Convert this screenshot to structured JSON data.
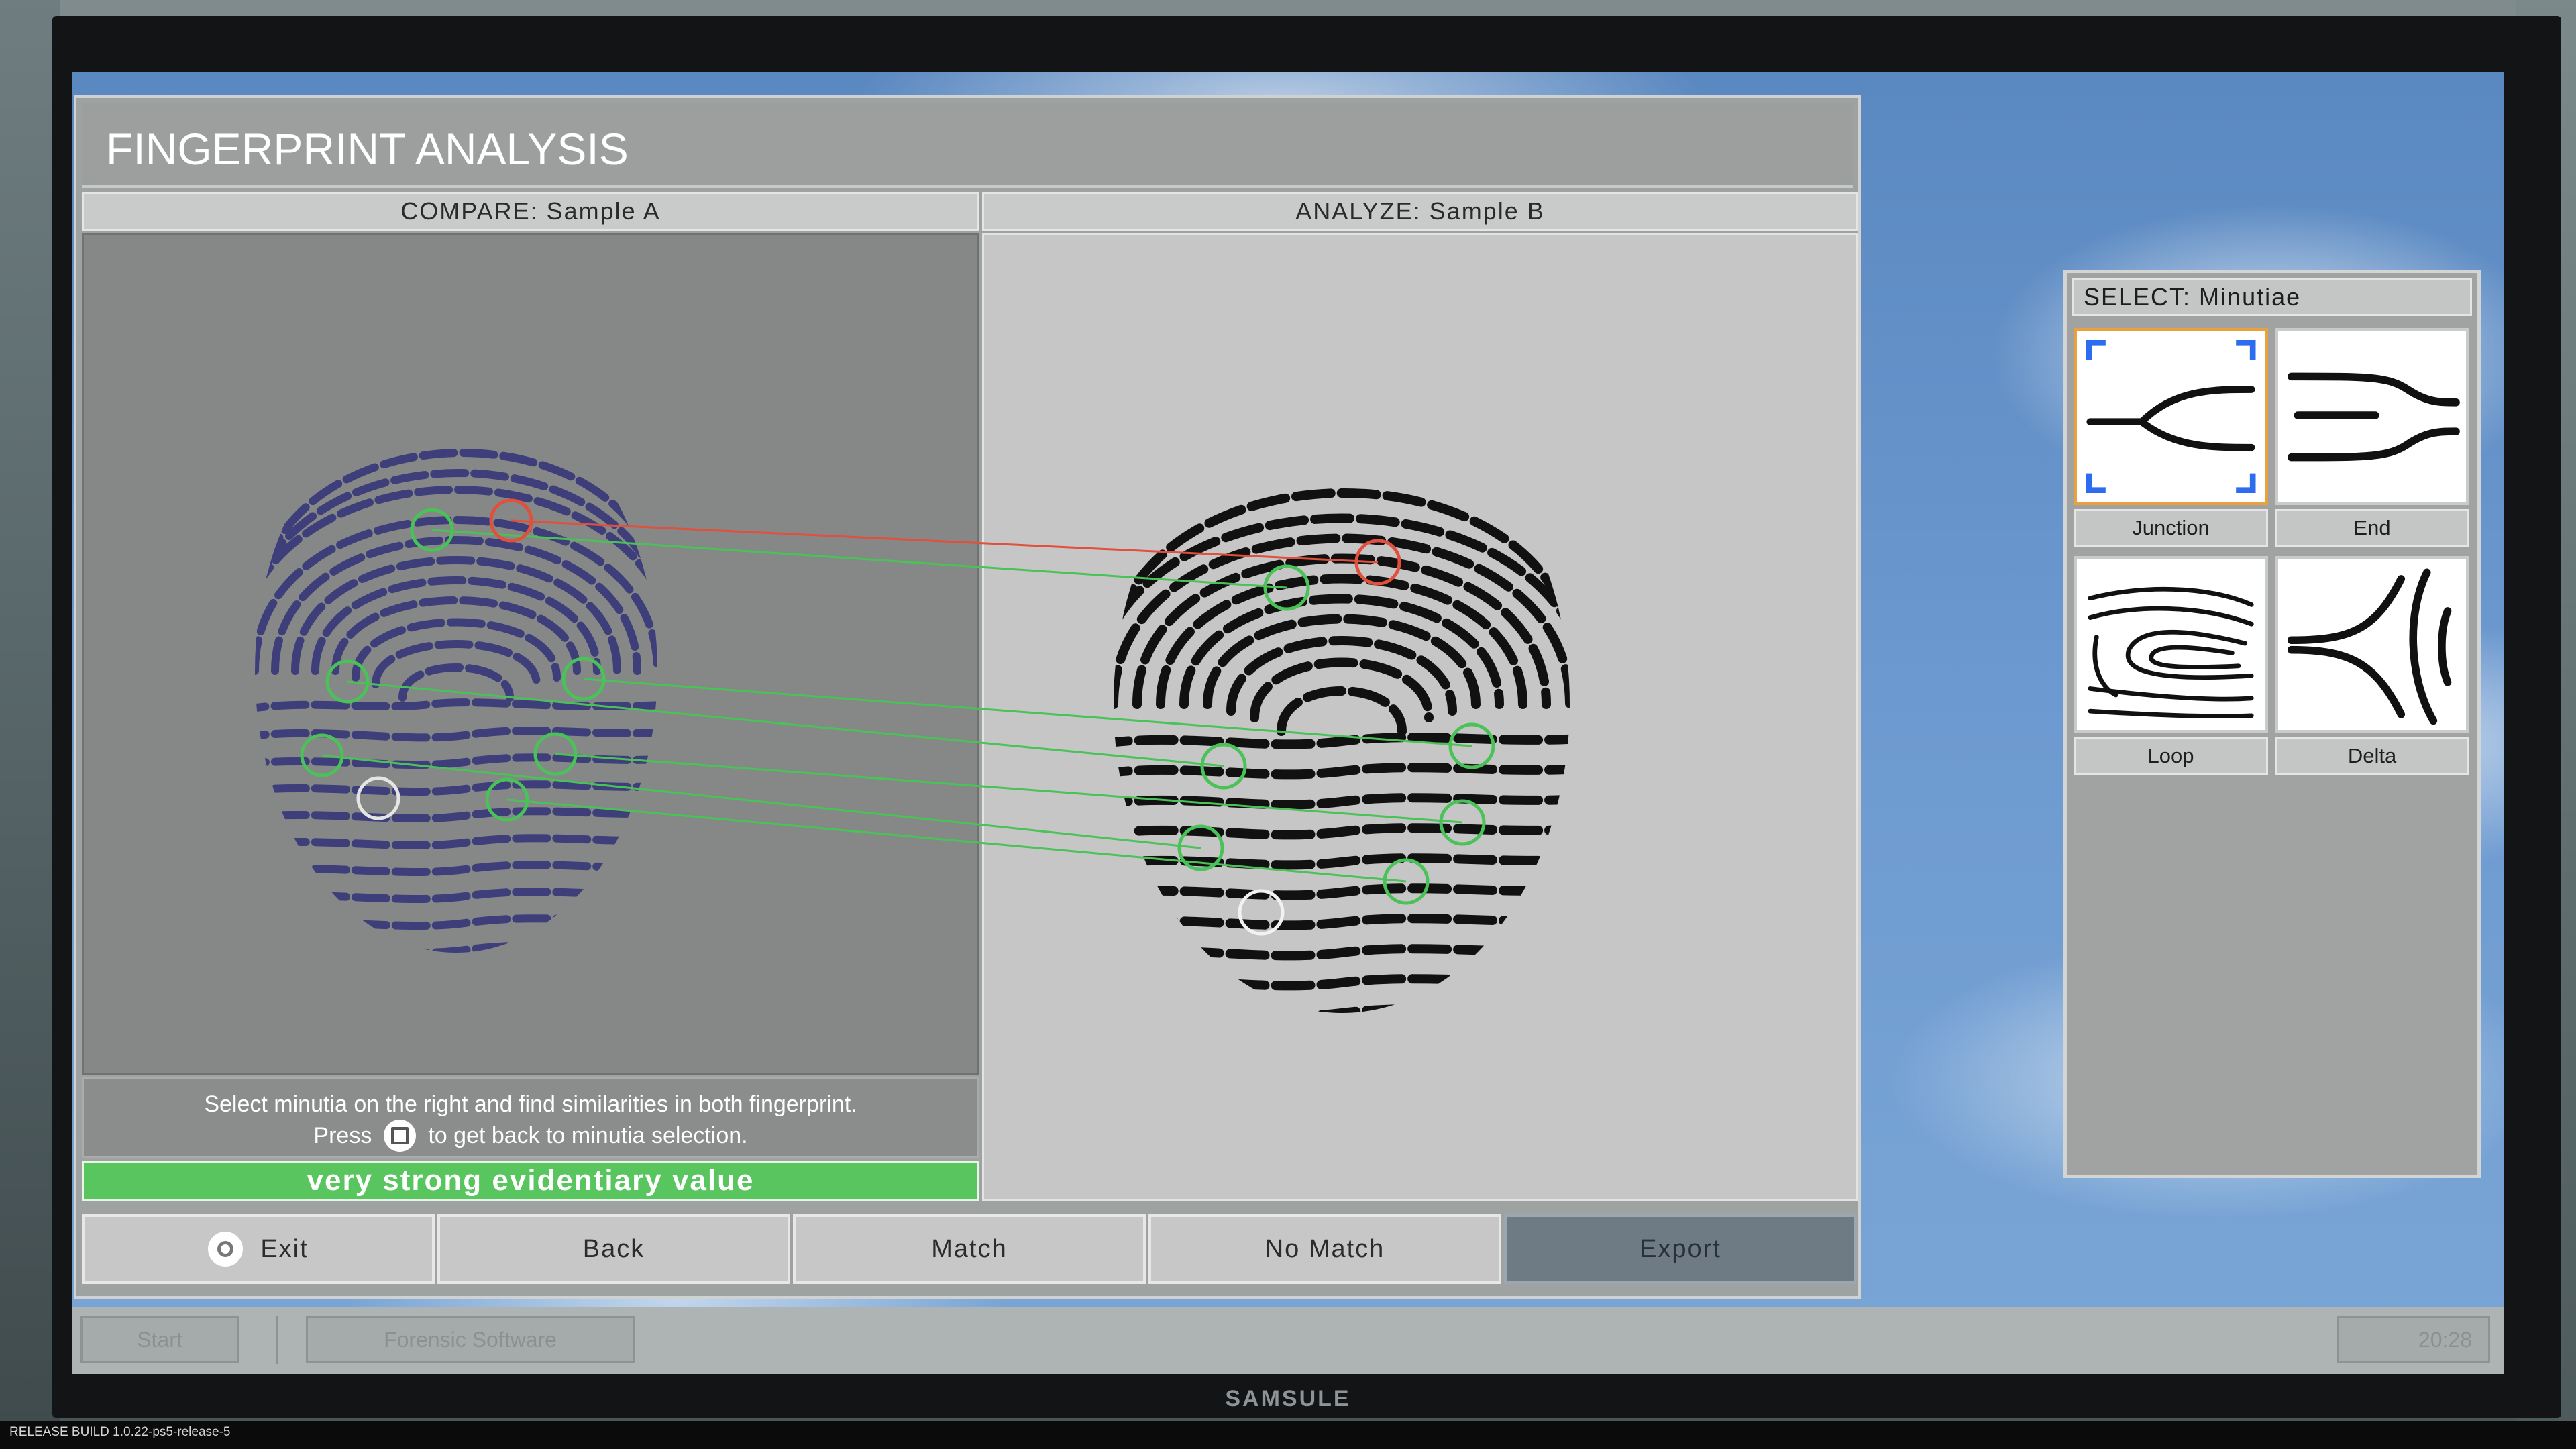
{
  "window": {
    "title": "FINGERPRINT ANALYSIS"
  },
  "compare_panel": {
    "title": "COMPARE: Sample A"
  },
  "analyze_panel": {
    "title": "ANALYZE: Sample B"
  },
  "instructions": {
    "line1": "Select minutia on the right and find similarities in both fingerprint.",
    "line2_before": "Press",
    "line2_after": "to get back to minutia selection."
  },
  "verdict": {
    "text": "very strong evidentiary value",
    "color": "#59c55e"
  },
  "buttons": {
    "exit": "Exit",
    "back": "Back",
    "match": "Match",
    "no_match": "No Match",
    "export": "Export"
  },
  "minutiae_panel": {
    "title": "SELECT: Minutiae",
    "items": [
      {
        "label": "Junction",
        "icon": "junction-icon",
        "selected": true
      },
      {
        "label": "End",
        "icon": "ridge-end-icon",
        "selected": false
      },
      {
        "label": "Loop",
        "icon": "loop-icon",
        "selected": false
      },
      {
        "label": "Delta",
        "icon": "delta-icon",
        "selected": false
      }
    ]
  },
  "taskbar": {
    "start": "Start",
    "forensic_software": "Forensic Software",
    "clock": "20:28"
  },
  "monitor_brand": "SAMSULE",
  "build_info": "RELEASE   BUILD 1.0.22-ps5-release-5",
  "colors": {
    "match_line": "#49c257",
    "selected_line": "#e0503c",
    "ink_a": "#3e3e7a",
    "ink_b": "#111111"
  }
}
